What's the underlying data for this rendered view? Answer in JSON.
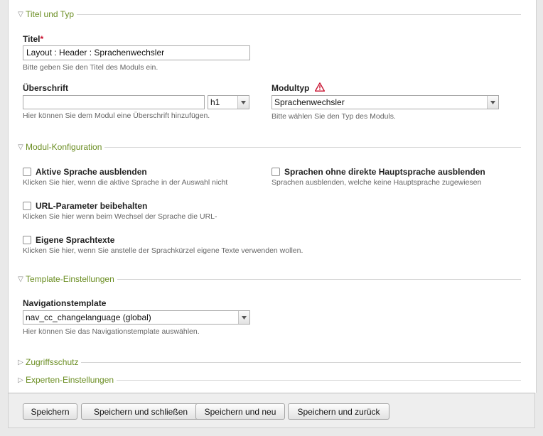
{
  "sections": {
    "titel_typ": "Titel und Typ",
    "modul_konfig": "Modul-Konfiguration",
    "template": "Template-Einstellungen",
    "zugriff": "Zugriffsschutz",
    "experten": "Experten-Einstellungen"
  },
  "fields": {
    "titel": {
      "label": "Titel",
      "required_mark": "*",
      "value": "Layout : Header : Sprachenwechsler",
      "help": "Bitte geben Sie den Titel des Moduls ein."
    },
    "ueberschrift": {
      "label": "Überschrift",
      "value": "",
      "level": "h1",
      "help": "Hier können Sie dem Modul eine Überschrift hinzufügen."
    },
    "modultyp": {
      "label": "Modultyp",
      "value": "Sprachenwechsler",
      "help": "Bitte wählen Sie den Typ des Moduls."
    },
    "navigationstemplate": {
      "label": "Navigationstemplate",
      "value": "nav_cc_changelanguage (global)",
      "help": "Hier können Sie das Navigationstemplate auswählen."
    }
  },
  "checkboxes": {
    "aktive_sprache": {
      "label": "Aktive Sprache ausblenden",
      "help": "Klicken Sie hier, wenn die aktive Sprache in der Auswahl nicht",
      "checked": false
    },
    "ohne_hauptsprache": {
      "label": "Sprachen ohne direkte Hauptsprache ausblenden",
      "help": "Sprachen ausblenden, welche keine Hauptsprache zugewiesen",
      "checked": false
    },
    "url_parameter": {
      "label": "URL-Parameter beibehalten",
      "help": "Klicken Sie hier wenn beim Wechsel der Sprache die URL-",
      "checked": false
    },
    "eigene_texte": {
      "label": "Eigene Sprachtexte",
      "help": "Klicken Sie hier, wenn Sie anstelle der Sprachkürzel eigene Texte verwenden wollen.",
      "checked": false
    }
  },
  "buttons": {
    "save": "Speichern",
    "save_close": "Speichern und schließen",
    "save_new": "Speichern und neu",
    "save_back": "Speichern und zurück"
  },
  "colors": {
    "legend_green": "#6b8e23",
    "required_red": "#c8102e",
    "warning_red": "#c8102e"
  }
}
